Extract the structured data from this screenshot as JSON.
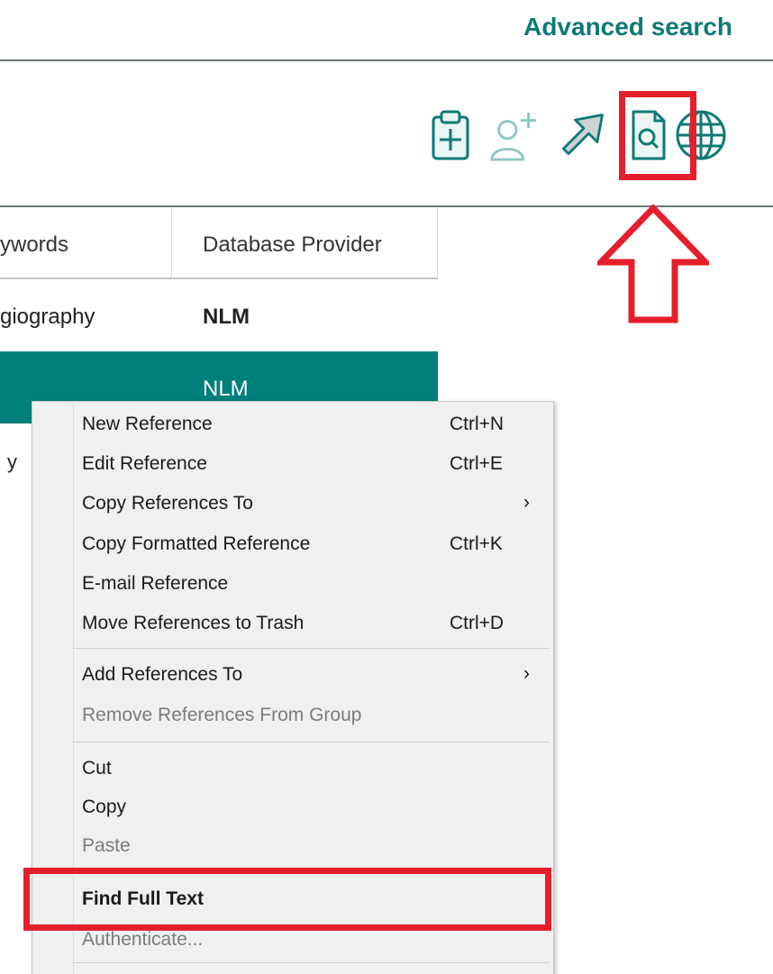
{
  "header": {
    "advanced_search": "Advanced search"
  },
  "toolbar": {
    "icons": [
      "clipboard-plus-icon",
      "add-person-icon",
      "share-arrow-icon",
      "find-full-text-icon",
      "globe-icon"
    ]
  },
  "colors": {
    "accent": "#0d7a74",
    "selected_row": "#007f7b",
    "highlight": "#e41e2b"
  },
  "table": {
    "columns": [
      "ywords",
      "Database Provider"
    ],
    "rows": [
      {
        "keywords": "giography",
        "provider": "NLM"
      },
      {
        "keywords": "",
        "provider": "NLM"
      },
      {
        "keywords": "у",
        "provider": ""
      }
    ]
  },
  "context_menu": {
    "items": [
      {
        "label": "New Reference",
        "shortcut": "Ctrl+N"
      },
      {
        "label": "Edit Reference",
        "shortcut": "Ctrl+E"
      },
      {
        "label": "Copy References To",
        "submenu": "›"
      },
      {
        "label": "Copy Formatted Reference",
        "shortcut": "Ctrl+K"
      },
      {
        "label": "E-mail Reference",
        "shortcut": ""
      },
      {
        "label": "Move References to Trash",
        "shortcut": "Ctrl+D"
      },
      {
        "label": "Add References To",
        "submenu": "›"
      },
      {
        "label": "Remove References From Group",
        "shortcut": ""
      },
      {
        "label": "Cut",
        "shortcut": ""
      },
      {
        "label": "Copy",
        "shortcut": ""
      },
      {
        "label": "Paste",
        "shortcut": ""
      },
      {
        "label": "Find Full Text",
        "shortcut": ""
      },
      {
        "label": "Authenticate...",
        "shortcut": ""
      }
    ]
  }
}
